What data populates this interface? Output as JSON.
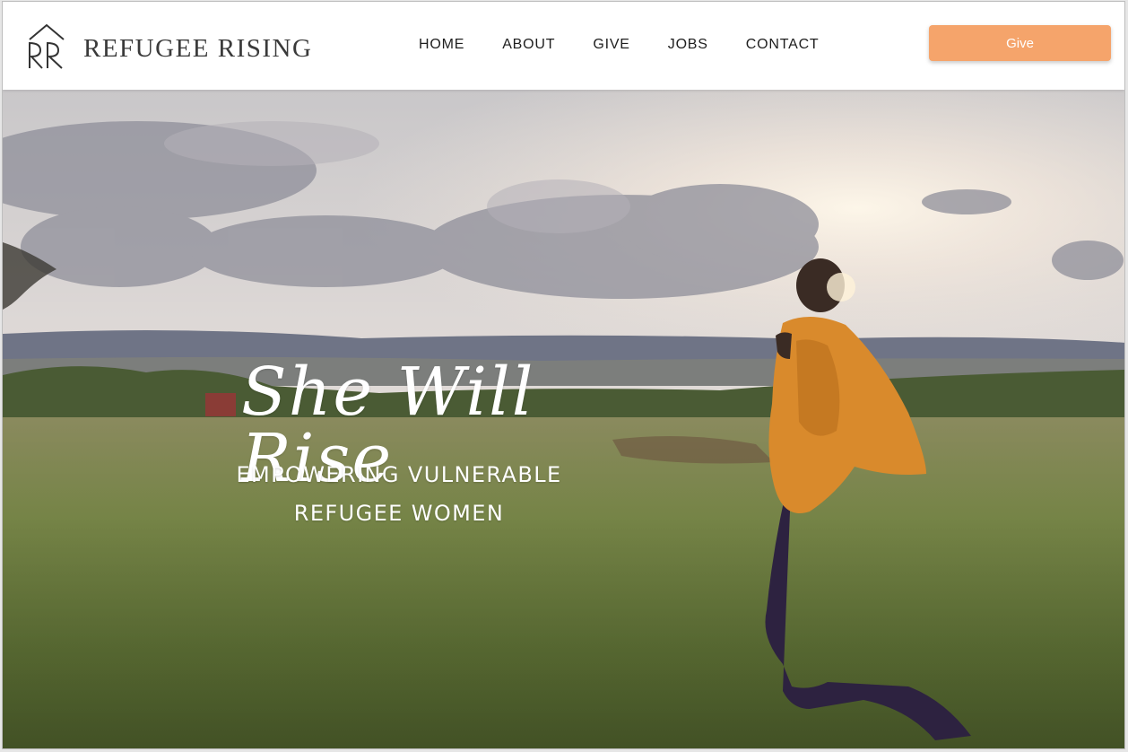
{
  "brand": {
    "name": "REFUGEE RISING",
    "logo_icon": "house-rr-monogram-icon"
  },
  "nav": {
    "items": [
      {
        "label": "HOME"
      },
      {
        "label": "ABOUT"
      },
      {
        "label": "GIVE"
      },
      {
        "label": "JOBS"
      },
      {
        "label": "CONTACT"
      }
    ]
  },
  "header": {
    "give_button_label": "Give",
    "accent_color": "#f5a46b"
  },
  "hero": {
    "title": "She Will Rise",
    "tagline_line1": "EMPOWERING VULNERABLE",
    "tagline_line2": "REFUGEE WOMEN",
    "image_subject": "woman-walking-in-field-photo"
  }
}
